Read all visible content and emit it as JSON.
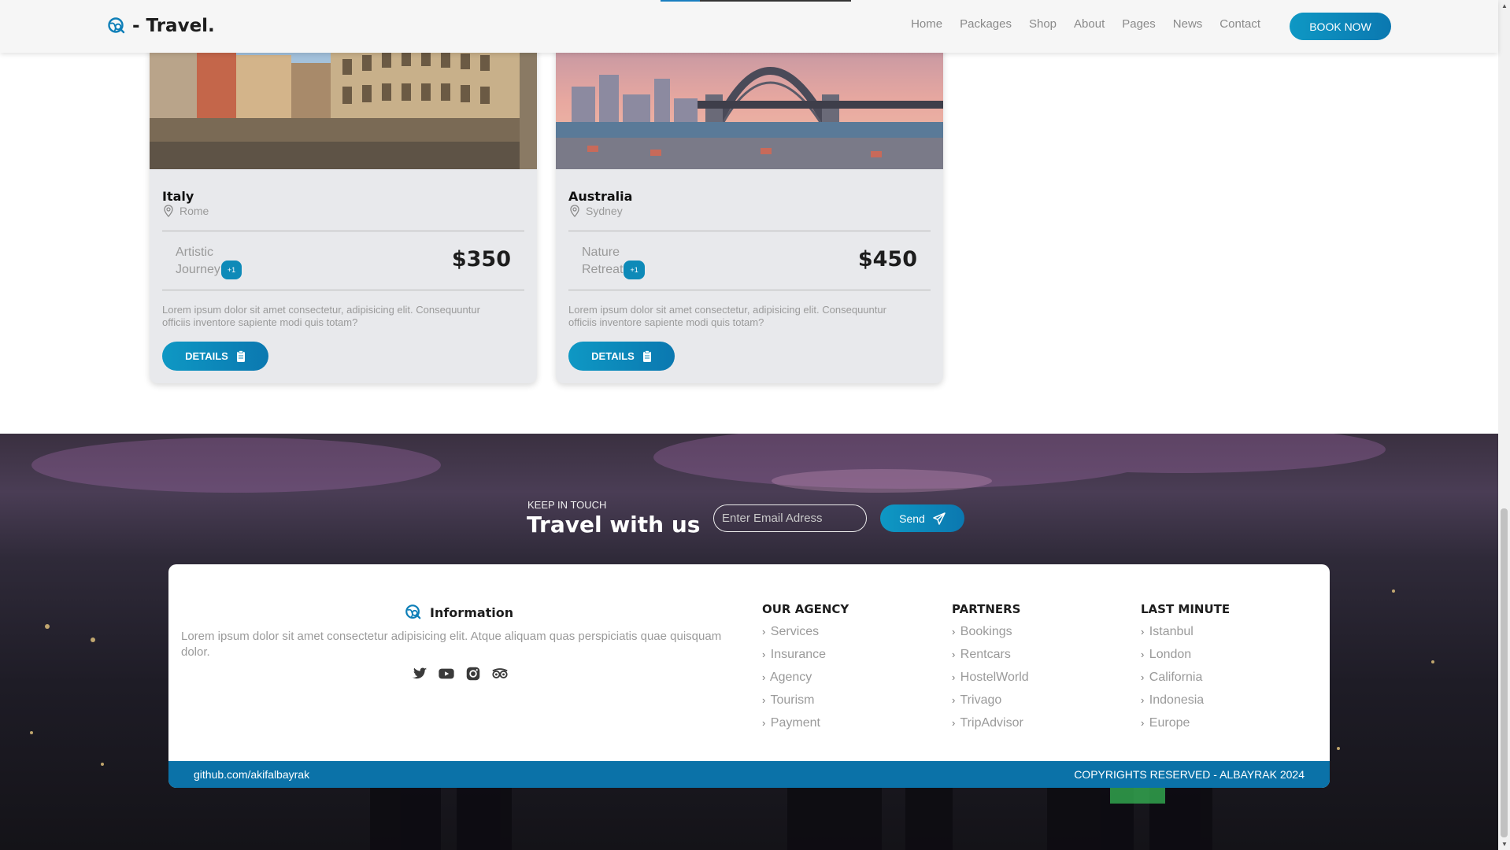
{
  "navbar": {
    "brand": "- Travel.",
    "links": [
      "Home",
      "Packages",
      "Shop",
      "About",
      "Pages",
      "News",
      "Contact"
    ],
    "cta": "BOOK NOW",
    "accent": "#0e98c4"
  },
  "cards": [
    {
      "title": "Italy",
      "location": "Rome",
      "type_line1": "Artistic",
      "type_line2": "Journey",
      "badge": "+1",
      "price": "$350",
      "description": "Lorem ipsum dolor sit amet consectetur, adipisicing elit. Consequuntur officiis inventore sapiente modi quis totam?",
      "button": "DETAILS"
    },
    {
      "title": "Australia",
      "location": "Sydney",
      "type_line1": "Nature",
      "type_line2": "Retreat",
      "badge": "+1",
      "price": "$450",
      "description": "Lorem ipsum dolor sit amet consectetur, adipisicing elit. Consequuntur officiis inventore sapiente modi quis totam?",
      "button": "DETAILS"
    }
  ],
  "newsletter": {
    "kicker": "KEEP IN TOUCH",
    "title": "Travel with us",
    "placeholder": "Enter Email Adress",
    "send": "Send"
  },
  "footer": {
    "info_title": "Information",
    "info_text": "Lorem ipsum dolor sit amet consectetur adipisicing elit. Atque aliquam quas perspiciatis quae quisquam dolor.",
    "socials": [
      "twitter-icon",
      "youtube-icon",
      "instagram-icon",
      "tripadvisor-icon"
    ],
    "columns": [
      {
        "title": "OUR AGENCY",
        "items": [
          "Services",
          "Insurance",
          "Agency",
          "Tourism",
          "Payment"
        ]
      },
      {
        "title": "PARTNERS",
        "items": [
          "Bookings",
          "Rentcars",
          "HostelWorld",
          "Trivago",
          "TripAdvisor"
        ]
      },
      {
        "title": "LAST MINUTE",
        "items": [
          "Istanbul",
          "London",
          "California",
          "Indonesia",
          "Europe"
        ]
      }
    ],
    "bar_left": "github.com/akifalbayrak",
    "bar_right": "COPYRIGHTS RESERVED - ALBAYRAK 2024",
    "bar_color": "#0b72a8"
  }
}
